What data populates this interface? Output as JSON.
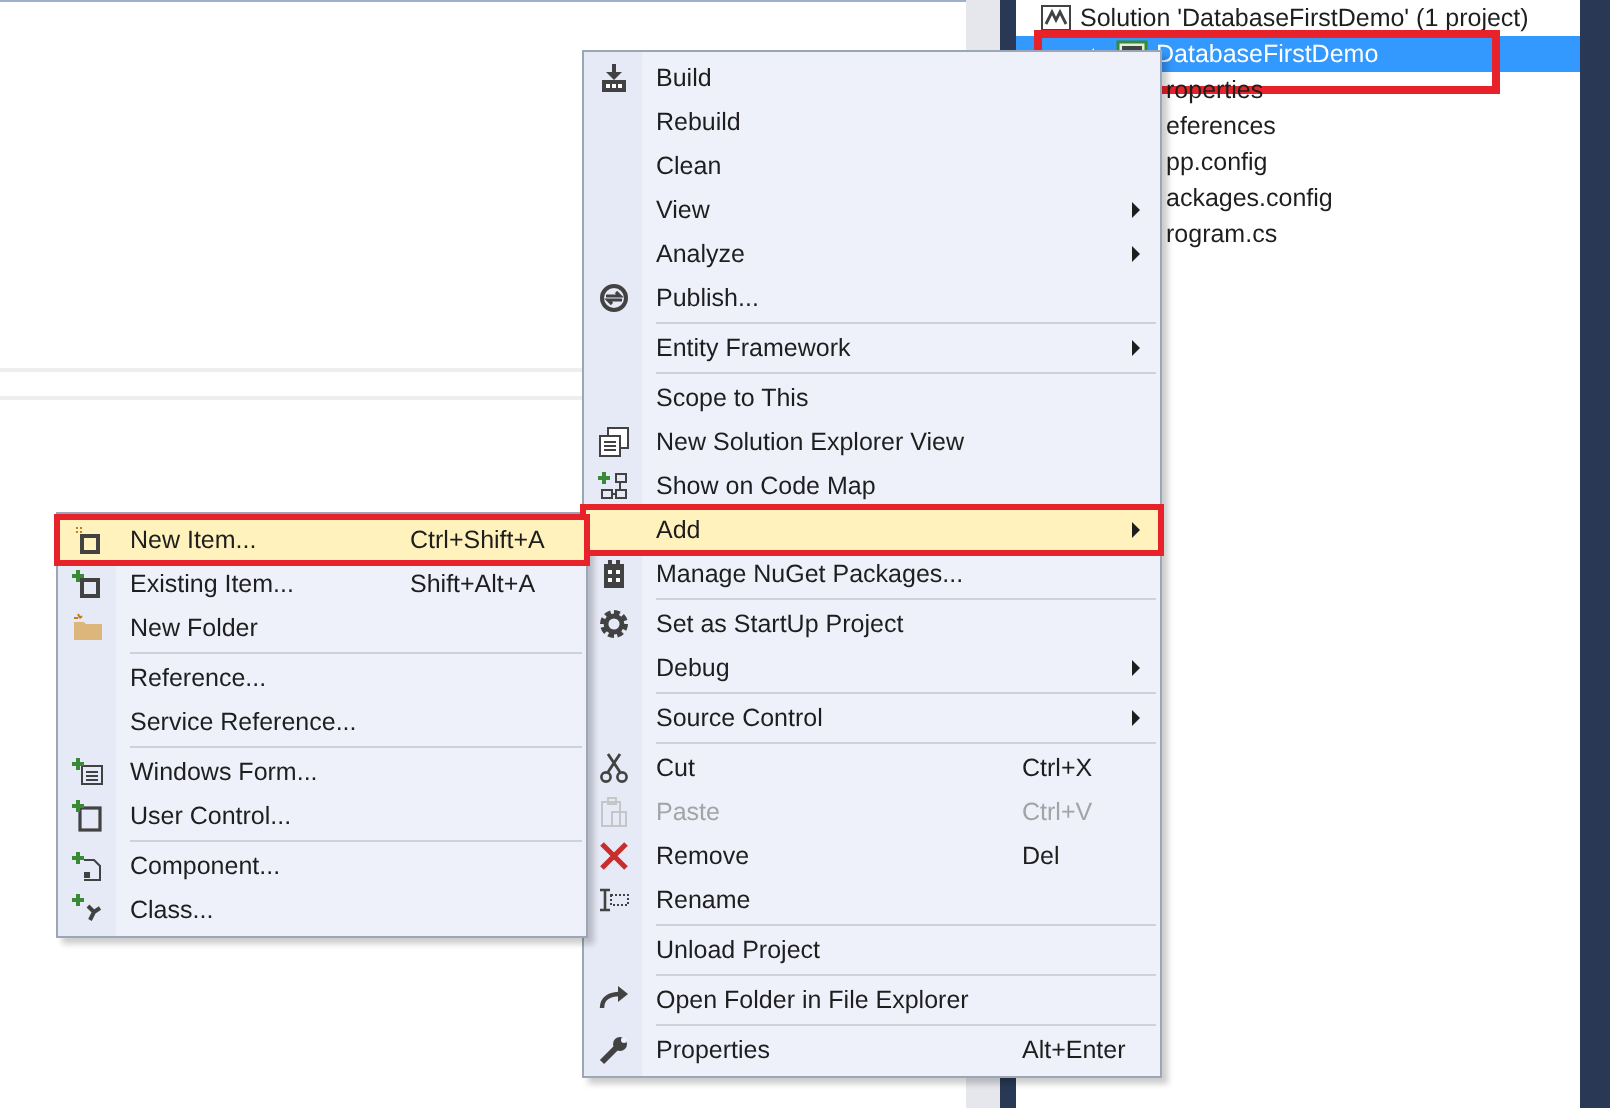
{
  "solution_explorer": {
    "items": [
      {
        "label": "Solution 'DatabaseFirstDemo' (1 project)",
        "selected": false,
        "children": [
          {
            "label": "DatabaseFirstDemo",
            "selected": true,
            "annotated": true,
            "expanded": true,
            "children": [
              {
                "label": "roperties",
                "selected": false
              },
              {
                "label": "eferences",
                "selected": false
              },
              {
                "label": "pp.config",
                "selected": false
              },
              {
                "label": "ackages.config",
                "selected": false
              },
              {
                "label": "rogram.cs",
                "selected": false
              }
            ]
          }
        ]
      }
    ]
  },
  "context_menu": {
    "groups": [
      [
        {
          "label": "Build",
          "selected": false,
          "disabled": false
        },
        {
          "label": "Rebuild",
          "selected": false,
          "disabled": false
        },
        {
          "label": "Clean",
          "selected": false,
          "disabled": false
        },
        {
          "label": "View",
          "has_submenu": true,
          "selected": false,
          "disabled": false
        },
        {
          "label": "Analyze",
          "has_submenu": true,
          "selected": false,
          "disabled": false
        },
        {
          "label": "Publish...",
          "selected": false,
          "disabled": false
        }
      ],
      [
        {
          "label": "Entity Framework",
          "has_submenu": true,
          "selected": false,
          "disabled": false
        }
      ],
      [
        {
          "label": "Scope to This",
          "selected": false,
          "disabled": false
        },
        {
          "label": "New Solution Explorer View",
          "selected": false,
          "disabled": false
        },
        {
          "label": "Show on Code Map",
          "selected": false,
          "disabled": false
        },
        {
          "label": "Add",
          "has_submenu": true,
          "selected": true,
          "disabled": false
        },
        {
          "label": "Manage NuGet Packages...",
          "selected": false,
          "disabled": false
        }
      ],
      [
        {
          "label": "Set as StartUp Project",
          "selected": false,
          "disabled": false
        },
        {
          "label": "Debug",
          "has_submenu": true,
          "selected": false,
          "disabled": false
        }
      ],
      [
        {
          "label": "Source Control",
          "has_submenu": true,
          "selected": false,
          "disabled": false
        }
      ],
      [
        {
          "label": "Cut",
          "shortcut": "Ctrl+X",
          "selected": false,
          "disabled": false
        },
        {
          "label": "Paste",
          "shortcut": "Ctrl+V",
          "selected": false,
          "disabled": true
        },
        {
          "label": "Remove",
          "shortcut": "Del",
          "selected": false,
          "disabled": false
        },
        {
          "label": "Rename",
          "selected": false,
          "disabled": false
        }
      ],
      [
        {
          "label": "Unload Project",
          "selected": false,
          "disabled": false
        }
      ],
      [
        {
          "label": "Open Folder in File Explorer",
          "selected": false,
          "disabled": false
        }
      ],
      [
        {
          "label": "Properties",
          "shortcut": "Alt+Enter",
          "selected": false,
          "disabled": false
        }
      ]
    ]
  },
  "add_submenu": {
    "groups": [
      [
        {
          "label": "New Item...",
          "shortcut": "Ctrl+Shift+A",
          "selected": true,
          "disabled": false
        },
        {
          "label": "Existing Item...",
          "shortcut": "Shift+Alt+A",
          "selected": false,
          "disabled": false
        },
        {
          "label": "New Folder",
          "selected": false,
          "disabled": false
        }
      ],
      [
        {
          "label": "Reference...",
          "selected": false,
          "disabled": false
        },
        {
          "label": "Service Reference...",
          "selected": false,
          "disabled": false
        }
      ],
      [
        {
          "label": "Windows Form...",
          "selected": false,
          "disabled": false
        },
        {
          "label": "User Control...",
          "selected": false,
          "disabled": false
        }
      ],
      [
        {
          "label": "Component...",
          "selected": false,
          "disabled": false
        },
        {
          "label": "Class...",
          "selected": false,
          "disabled": false
        }
      ]
    ]
  }
}
